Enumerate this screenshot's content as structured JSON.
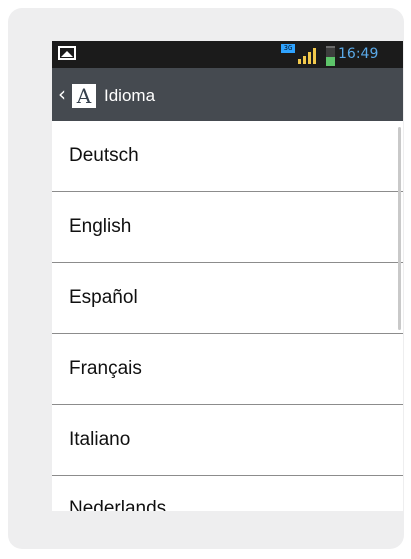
{
  "status_bar": {
    "network_badge": "3G",
    "time": "16:49",
    "icons": [
      "picture-notification-icon",
      "signal-bars-icon",
      "battery-icon"
    ],
    "time_color": "#5aa9e8"
  },
  "action_bar": {
    "title": "Idioma",
    "app_icon_letter": "A",
    "background": "#454a50"
  },
  "languages": [
    {
      "label": "Deutsch"
    },
    {
      "label": "English"
    },
    {
      "label": "Español"
    },
    {
      "label": "Français"
    },
    {
      "label": "Italiano"
    },
    {
      "label": "Nederlands"
    }
  ]
}
